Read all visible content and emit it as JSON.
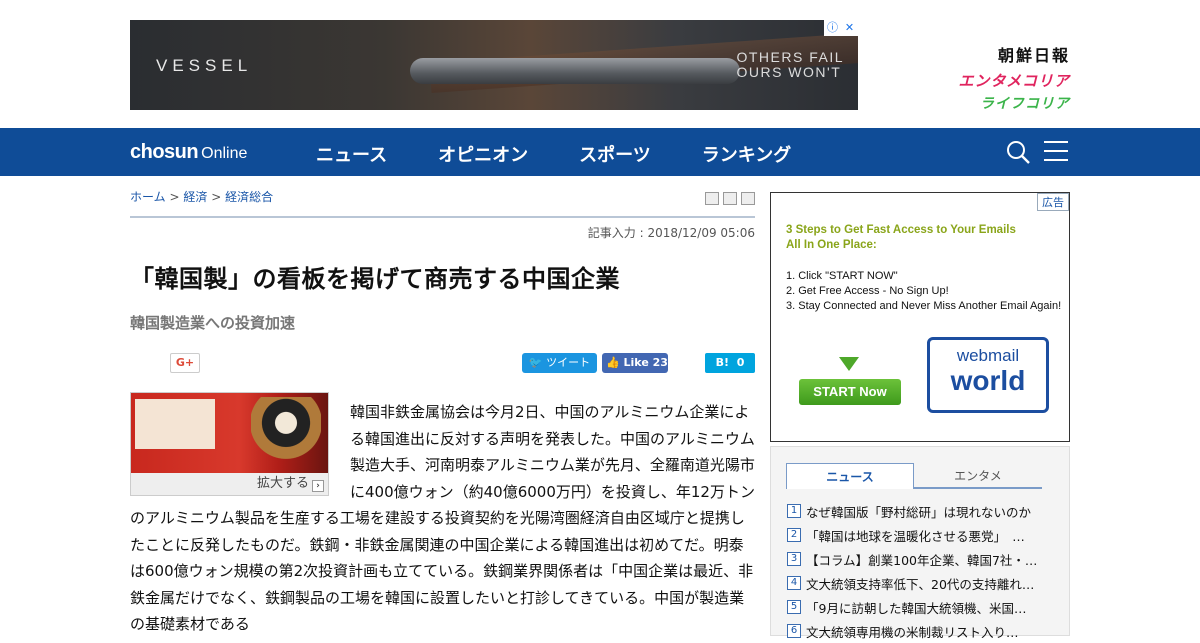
{
  "ad_banner": {
    "brand": "VESSEL",
    "tagline_line1": "OTHERS FAIL",
    "tagline_line2": "OURS WON'T",
    "close_icons": [
      "ⓘ",
      "✕"
    ]
  },
  "brand_links": {
    "chosun": "朝鮮日報",
    "entame": "エンタメコリア",
    "life": "ライフコリア"
  },
  "nav": {
    "logo_bold": "chosun",
    "logo_light": "Online",
    "items": [
      "ニュース",
      "オピニオン",
      "スポーツ",
      "ランキング"
    ],
    "search_icon": "search-icon",
    "menu_icon": "hamburger-icon",
    "color": "#0f4c97"
  },
  "article": {
    "breadcrumb": [
      "ホーム",
      "経済",
      "経済総合"
    ],
    "breadcrumb_sep": ">",
    "dateline": "記事入力 : 2018/12/09 05:06",
    "headline": "「韓国製」の看板を掲げて商売する中国企業",
    "subhead": "韓国製造業への投資加速",
    "share": {
      "gplus": "G+",
      "tweet": "ツイート",
      "fb_like": "Like",
      "fb_count": "23",
      "hatena": "B!",
      "hatena_count": "0"
    },
    "photo_caption": "拡大する",
    "photo_caption_icon": "›",
    "body": "韓国非鉄金属協会は今月2日、中国のアルミニウム企業による韓国進出に反対する声明を発表した。中国のアルミニウム製造大手、河南明泰アルミニウム業が先月、全羅南道光陽市に400億ウォン（約40億6000万円）を投資し、年12万トンのアルミニウム製品を生産する工場を建設する投資契約を光陽湾圏経済自由区域庁と提携したことに反発したものだ。鉄鋼・非鉄金属関連の中国企業による韓国進出は初めてだ。明泰は600億ウォン規模の第2次投資計画も立てている。鉄鋼業界関係者は「中国企業は最近、非鉄金属だけでなく、鉄鋼製品の工場を韓国に設置したいと打診してきている。中国が製造業の基礎素材である"
  },
  "side_ad": {
    "label": "広告",
    "title_line1": "3 Steps to Get Fast Access to Your Emails",
    "title_line2": "All In One Place:",
    "steps": [
      "1. Click \"START NOW\"",
      "2. Get Free Access - No Sign Up!",
      "3. Stay Connected and Never Miss Another Email Again!"
    ],
    "start_button": "START Now",
    "logo_line1": "webmail",
    "logo_line2": "world"
  },
  "ranking": {
    "tabs": [
      "ニュース",
      "エンタメ"
    ],
    "items": [
      {
        "n": "1",
        "title": "なぜ韓国版「野村総研」は現れないのか"
      },
      {
        "n": "2",
        "title": "「韓国は地球を温暖化させる悪党」　…"
      },
      {
        "n": "3",
        "title": "【コラム】創業100年企業、韓国7社・…"
      },
      {
        "n": "4",
        "title": "文大統領支持率低下、20代の支持離れ…"
      },
      {
        "n": "5",
        "title": "「9月に訪朝した韓国大統領機、米国…"
      },
      {
        "n": "6",
        "title": "文大統領専用機の米制裁リスト入り…"
      }
    ]
  }
}
